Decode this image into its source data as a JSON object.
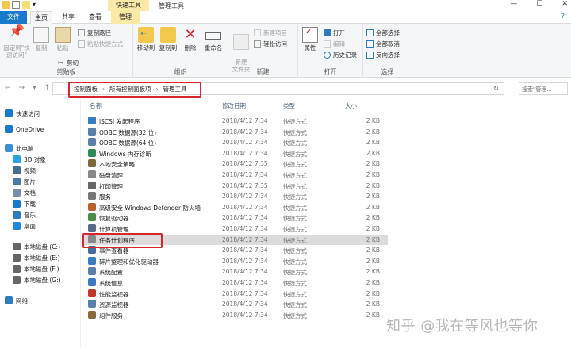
{
  "window": {
    "context_tab_header": "快速工具",
    "title": "管理工具",
    "controls": [
      "—",
      "☐",
      "✕"
    ]
  },
  "tabs": {
    "file": "文件",
    "home": "主页",
    "share": "共享",
    "view": "查看",
    "manage": "管理"
  },
  "ribbon": {
    "pin_label": "固定到\"快速访问\"",
    "copy_label": "复制",
    "paste_label": "粘贴",
    "copy_path": "复制路径",
    "paste_shortcut": "粘贴快捷方式",
    "cut": "剪切",
    "group_clipboard": "剪贴板",
    "move_to": "移动到",
    "copy_to": "复制到",
    "delete": "删除",
    "rename": "重命名",
    "group_organize": "组织",
    "new_folder": "新建\n文件夹",
    "new_item": "新建项目",
    "easy_access": "轻松访问",
    "group_new": "新建",
    "properties": "属性",
    "open": "打开",
    "edit": "编辑",
    "history": "历史记录",
    "group_open": "打开",
    "select_all": "全部选择",
    "select_none": "全部取消",
    "invert_select": "反向选择",
    "group_select": "选择"
  },
  "address": {
    "crumbs": [
      "控制面板",
      "所有控制面板项",
      "管理工具"
    ],
    "search_placeholder": "搜索\"管理...",
    "refresh": "↻"
  },
  "sidebar": [
    {
      "label": "快速访问",
      "icon": "star-icon",
      "color": "#1979ca"
    },
    {
      "label": "OneDrive",
      "icon": "cloud-icon",
      "color": "#1979ca"
    },
    {
      "label": "此电脑",
      "icon": "computer-icon",
      "color": "#3b8ed0"
    },
    {
      "label": "3D 对象",
      "icon": "cube-icon",
      "color": "#2aa4e0"
    },
    {
      "label": "视频",
      "icon": "video-icon",
      "color": "#4b6b8a"
    },
    {
      "label": "图片",
      "icon": "picture-icon",
      "color": "#4b7aa8"
    },
    {
      "label": "文档",
      "icon": "document-icon",
      "color": "#7a8ea8"
    },
    {
      "label": "下载",
      "icon": "download-icon",
      "color": "#1979ca"
    },
    {
      "label": "音乐",
      "icon": "music-icon",
      "color": "#2e7bbd"
    },
    {
      "label": "桌面",
      "icon": "desktop-icon",
      "color": "#1e88d8"
    },
    {
      "label": "本地磁盘 (C:)",
      "icon": "drive-icon",
      "color": "#666"
    },
    {
      "label": "本地磁盘 (E:)",
      "icon": "drive-icon",
      "color": "#666"
    },
    {
      "label": "本地磁盘 (F:)",
      "icon": "drive-icon",
      "color": "#666"
    },
    {
      "label": "本地磁盘 (G:)",
      "icon": "drive-icon",
      "color": "#666"
    },
    {
      "label": "网络",
      "icon": "network-icon",
      "color": "#2e7bbd"
    }
  ],
  "columns": {
    "name": "名称",
    "date": "修改日期",
    "type": "类型",
    "size": "大小"
  },
  "files": [
    {
      "name": "iSCSI 发起程序",
      "date": "2018/4/12 7:34",
      "type": "快捷方式",
      "size": "2 KB",
      "color": "#3b7bbf"
    },
    {
      "name": "ODBC 数据源(32 位)",
      "date": "2018/4/12 7:34",
      "type": "快捷方式",
      "size": "2 KB",
      "color": "#5a7fa8"
    },
    {
      "name": "ODBC 数据源(64 位)",
      "date": "2018/4/12 7:34",
      "type": "快捷方式",
      "size": "2 KB",
      "color": "#5a7fa8"
    },
    {
      "name": "Windows 内存诊断",
      "date": "2018/4/12 7:34",
      "type": "快捷方式",
      "size": "2 KB",
      "color": "#2e8b57"
    },
    {
      "name": "本地安全策略",
      "date": "2018/4/12 7:35",
      "type": "快捷方式",
      "size": "2 KB",
      "color": "#7a6a3a"
    },
    {
      "name": "磁盘清理",
      "date": "2018/4/12 7:34",
      "type": "快捷方式",
      "size": "2 KB",
      "color": "#888"
    },
    {
      "name": "打印管理",
      "date": "2018/4/12 7:35",
      "type": "快捷方式",
      "size": "2 KB",
      "color": "#666"
    },
    {
      "name": "服务",
      "date": "2018/4/12 7:34",
      "type": "快捷方式",
      "size": "2 KB",
      "color": "#777"
    },
    {
      "name": "高级安全 Windows Defender 防火墙",
      "date": "2018/4/12 7:34",
      "type": "快捷方式",
      "size": "2 KB",
      "color": "#b8622a"
    },
    {
      "name": "恢复驱动器",
      "date": "2018/4/12 7:34",
      "type": "快捷方式",
      "size": "2 KB",
      "color": "#4a8a4a"
    },
    {
      "name": "计算机管理",
      "date": "2018/4/12 7:34",
      "type": "快捷方式",
      "size": "2 KB",
      "color": "#5a6a8a"
    },
    {
      "name": "任务计划程序",
      "date": "2018/4/12 7:34",
      "type": "快捷方式",
      "size": "2 KB",
      "color": "#888",
      "selected": true
    },
    {
      "name": "事件查看器",
      "date": "2018/4/12 7:34",
      "type": "快捷方式",
      "size": "2 KB",
      "color": "#4a6a9a"
    },
    {
      "name": "碎片整理和优化驱动器",
      "date": "2018/4/12 7:34",
      "type": "快捷方式",
      "size": "2 KB",
      "color": "#3b7bbf"
    },
    {
      "name": "系统配置",
      "date": "2018/4/12 7:34",
      "type": "快捷方式",
      "size": "2 KB",
      "color": "#5a7fa8"
    },
    {
      "name": "系统信息",
      "date": "2018/4/12 7:34",
      "type": "快捷方式",
      "size": "2 KB",
      "color": "#3b7bbf"
    },
    {
      "name": "性能监视器",
      "date": "2018/4/12 7:34",
      "type": "快捷方式",
      "size": "2 KB",
      "color": "#c0392b"
    },
    {
      "name": "资源监视器",
      "date": "2018/4/12 7:34",
      "type": "快捷方式",
      "size": "2 KB",
      "color": "#5a7fa8"
    },
    {
      "name": "组件服务",
      "date": "2018/4/12 7:34",
      "type": "快捷方式",
      "size": "2 KB",
      "color": "#8a6a3a"
    }
  ],
  "watermark": "知乎 @我在等风也等你"
}
